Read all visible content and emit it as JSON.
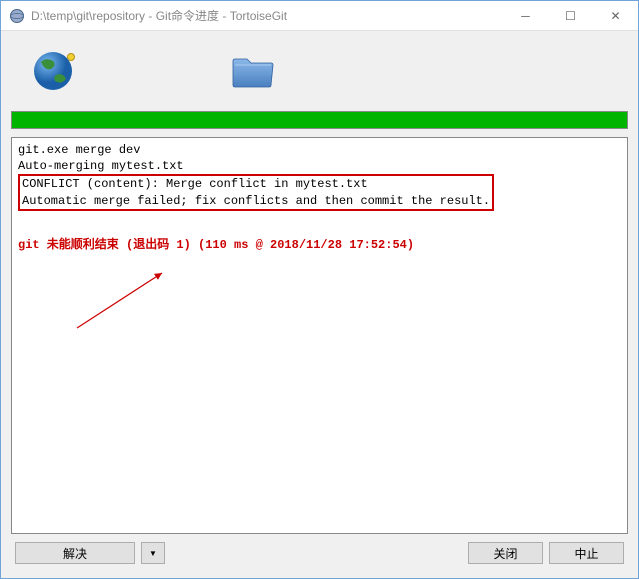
{
  "window": {
    "title": "D:\\temp\\git\\repository - Git命令进度 - TortoiseGit"
  },
  "log": {
    "line1": "git.exe merge dev",
    "blank1": "",
    "line2": "Auto-merging mytest.txt",
    "conflict1": "CONFLICT (content): Merge conflict in mytest.txt",
    "conflict2": "Automatic merge failed; fix conflicts and then commit the result.",
    "error": "git 未能顺利结束 (退出码 1) (110 ms @ 2018/11/28 17:52:54)"
  },
  "buttons": {
    "resolve": "解决",
    "dropdown": "▼",
    "close": "关闭",
    "abort": "中止"
  },
  "win_controls": {
    "minimize": "─",
    "maximize": "☐",
    "close": "✕"
  }
}
